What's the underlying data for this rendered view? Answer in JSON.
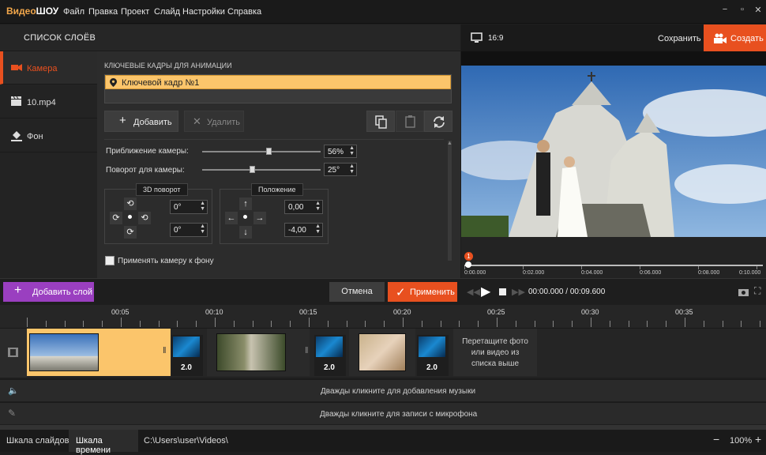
{
  "app": {
    "logo_a": "Видео",
    "logo_b": "ШОУ"
  },
  "menu": [
    "Файл",
    "Правка",
    "Проект",
    "Слайд",
    "Настройки",
    "Справка"
  ],
  "window": {
    "minimize": "−",
    "restore": "▫",
    "close": "✕"
  },
  "layers": {
    "title": "СПИСОК СЛОЁВ",
    "items": [
      {
        "label": "Камера",
        "icon": "camera-icon"
      },
      {
        "label": "10.mp4",
        "icon": "clapper-icon"
      },
      {
        "label": "Фон",
        "icon": "paint-bucket-icon"
      }
    ]
  },
  "keyframes": {
    "title": "КЛЮЧЕВЫЕ КАДРЫ ДЛЯ АНИМАЦИИ",
    "items": [
      "Ключевой кадр №1"
    ],
    "add_label": "Добавить",
    "delete_label": "Удалить"
  },
  "camera": {
    "zoom_label": "Приближение камеры:",
    "zoom_value": "56%",
    "zoom_level": 0.56,
    "rotate_label": "Поворот для камеры:",
    "rotate_value": "25°",
    "rotate_level": 0.42
  },
  "rotation3d": {
    "title": "3D поворот",
    "x": "0°",
    "y": "0°"
  },
  "position": {
    "title": "Положение",
    "x": "0,00",
    "y": "-4,00"
  },
  "apply_bg_label": "Применять камеру к фону",
  "preview": {
    "ratio": "16:9",
    "save": "Сохранить",
    "create": "Создать",
    "ticks": [
      "0:00.000",
      "0:02.000",
      "0:04.000",
      "0:06.000",
      "0:08.000",
      "0:10.000"
    ],
    "marker": "1"
  },
  "actions": {
    "add_layer": "Добавить слой",
    "cancel": "Отмена",
    "apply": "Применить"
  },
  "player": {
    "time": "00:00.000 / 00:09.600"
  },
  "ruler": {
    "ticks": [
      "00:05",
      "00:10",
      "00:15",
      "00:20",
      "00:25",
      "00:30",
      "00:35"
    ]
  },
  "timeline": {
    "transitions": [
      "2.0",
      "2.0",
      "2.0"
    ],
    "drop_hint": "Перетащите фото или видео из списка выше",
    "music_hint": "Дважды кликните для добавления музыки",
    "mic_hint": "Дважды кликните для записи с микрофона"
  },
  "status": {
    "tab_slides": "Шкала слайдов",
    "tab_timeline": "Шкала времени",
    "path": "C:\\Users\\user\\Videos\\",
    "zoom": "100%",
    "zoom_minus": "−",
    "zoom_plus": "+"
  },
  "colors": {
    "accent": "#e8501f",
    "keyframe": "#fbc56b",
    "purple": "#9a3fc0"
  }
}
